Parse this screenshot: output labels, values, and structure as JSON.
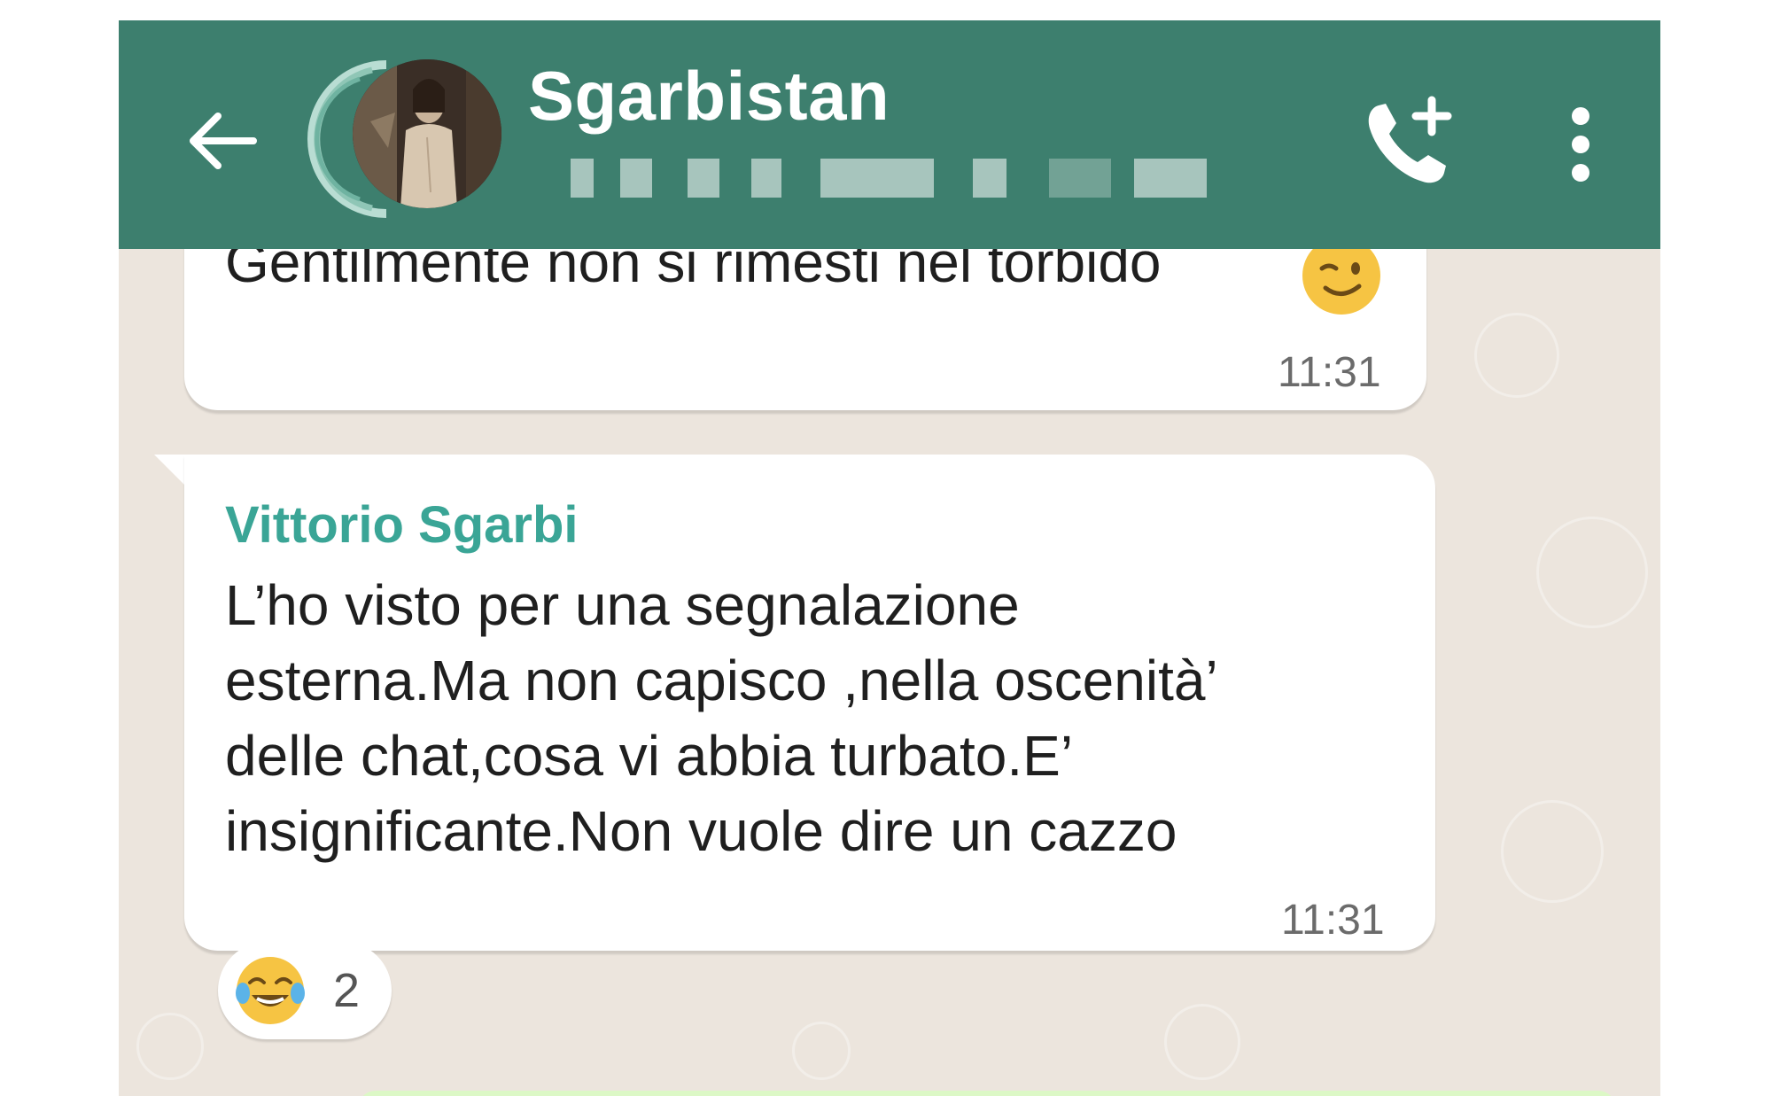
{
  "header": {
    "title": "Sgarbistan",
    "colors": {
      "bar": "#3d7f6e",
      "title": "#ffffff"
    },
    "icons": {
      "back": "arrow-left-icon",
      "call": "add-call-icon",
      "menu": "more-vertical-icon"
    }
  },
  "messages": [
    {
      "text": "Gentilmente non si rimesti nel torbido",
      "emoji": "winking-face-emoji",
      "time": "11:31"
    },
    {
      "sender": "Vittorio Sgarbi",
      "sender_color": "#3aa596",
      "lines": [
        "L’ho visto per una segnalazione",
        "esterna.Ma non capisco ,nella oscenità’",
        "delle chat,cosa vi abbia turbato.E’",
        "insignificante.Non vuole dire un cazzo"
      ],
      "time": "11:31",
      "reaction": {
        "emoji": "face-with-tears-of-joy-emoji",
        "count": "2"
      }
    }
  ]
}
